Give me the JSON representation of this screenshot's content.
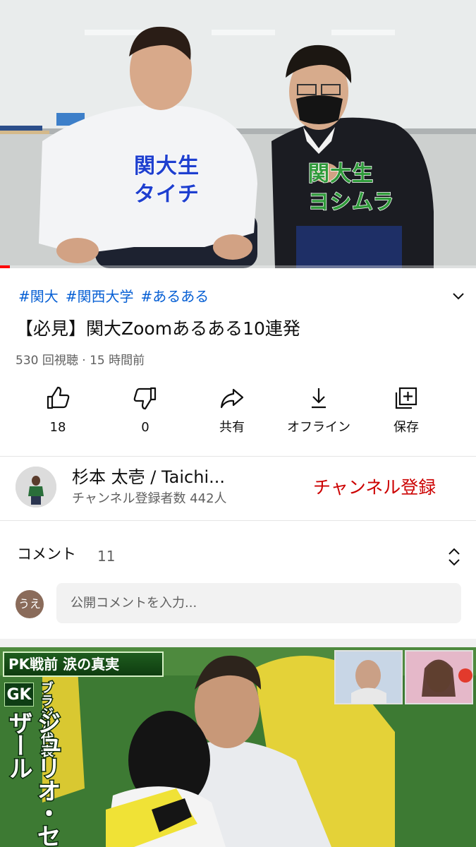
{
  "player": {
    "caption_left_line1": "関大生",
    "caption_left_line2": "タイチ",
    "caption_right_line1": "関大生",
    "caption_right_line2": "ヨシムラ",
    "progress_fraction": 0.02
  },
  "video": {
    "tags": [
      "#関大",
      "#関西大学",
      "#あるある"
    ],
    "title": "【必見】関大Zoomあるある10連発",
    "meta": "530 回視聴 · 15 時間前"
  },
  "actions": {
    "like": {
      "label": "18",
      "icon": "thumbs-up-icon"
    },
    "dislike": {
      "label": "0",
      "icon": "thumbs-down-icon"
    },
    "share": {
      "label": "共有",
      "icon": "share-arrow-icon"
    },
    "offline": {
      "label": "オフライン",
      "icon": "download-icon"
    },
    "save": {
      "label": "保存",
      "icon": "add-to-playlist-icon"
    }
  },
  "channel": {
    "name": "杉本 太壱 / Taichi...",
    "subscribers": "チャンネル登録者数 442人",
    "subscribe_label": "チャンネル登録"
  },
  "comments": {
    "title": "コメント",
    "count": "11",
    "avatar_text": "うえ",
    "placeholder": "公開コメントを入力..."
  },
  "next_video": {
    "banner": "PK戦前  涙の真実",
    "badge": "GK",
    "sub_caption": "ブラジル代表",
    "main_caption": "ジュリオ・セザール"
  },
  "colors": {
    "link_blue": "#065fd4",
    "subscribe_red": "#cc0000",
    "progress_red": "#ff0000",
    "secondary_text": "#606060"
  }
}
